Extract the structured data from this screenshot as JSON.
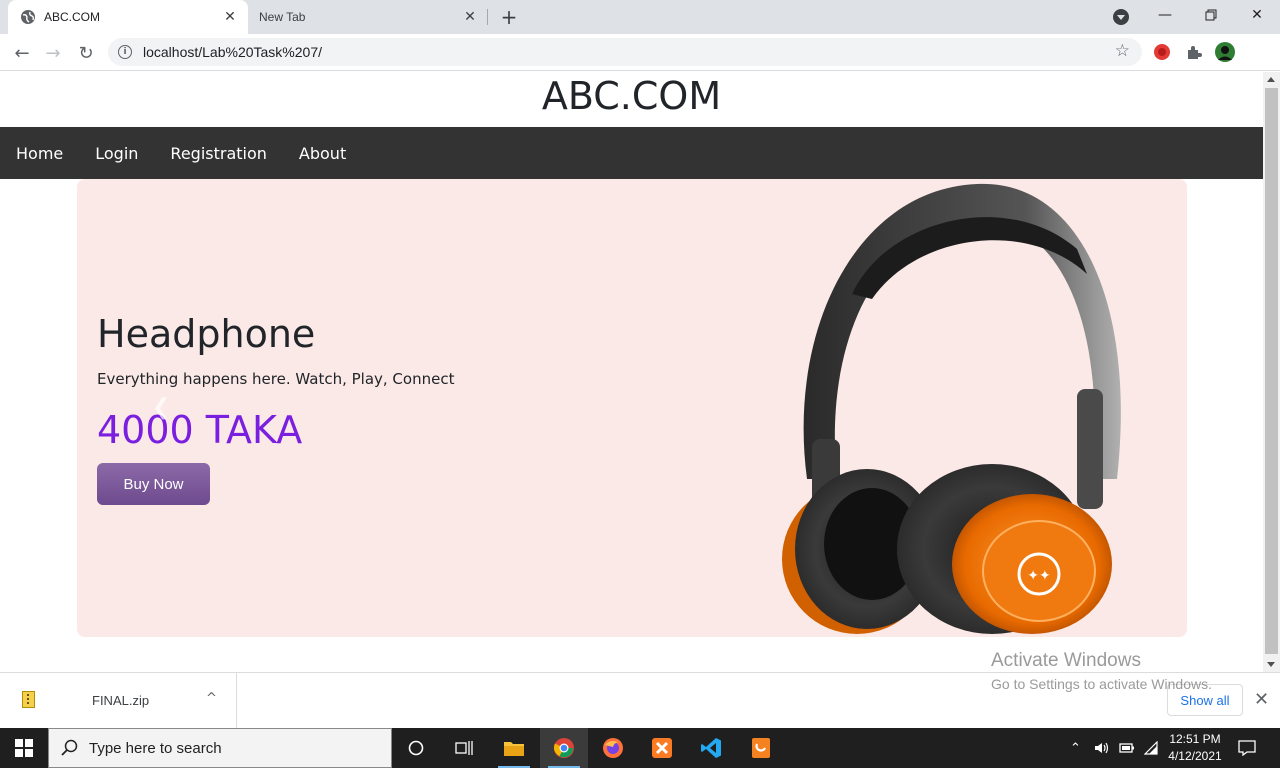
{
  "browser": {
    "tabs": [
      {
        "title": "ABC.COM",
        "active": true
      },
      {
        "title": "New Tab",
        "active": false
      }
    ],
    "url": "localhost/Lab%20Task%207/"
  },
  "site": {
    "title": "ABC.COM",
    "nav": [
      "Home",
      "Login",
      "Registration",
      "About"
    ]
  },
  "hero": {
    "heading": "Headphone",
    "subtitle": "Everything happens here. Watch, Play, Connect",
    "price": "4000 TAKA",
    "button": "Buy Now"
  },
  "watermark": {
    "line1": "Activate Windows",
    "line2": "Go to Settings to activate Windows."
  },
  "downloads": {
    "file": "FINAL.zip",
    "show_all": "Show all"
  },
  "taskbar": {
    "search_placeholder": "Type here to search",
    "time": "12:51 PM",
    "date": "4/12/2021"
  },
  "colors": {
    "navbar": "#333333",
    "hero_bg": "#fbe9e7",
    "price": "#7a1ee0",
    "button": "#7b5a9a"
  }
}
